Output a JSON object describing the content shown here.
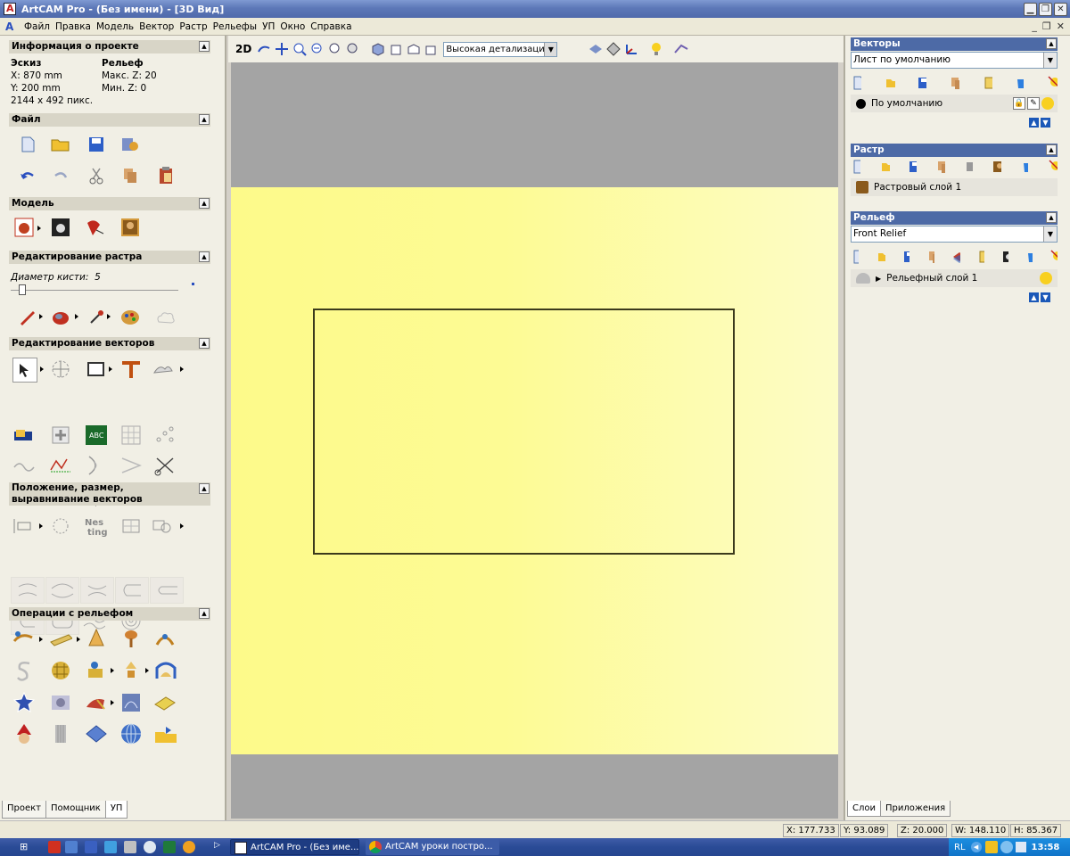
{
  "window": {
    "title": "ArtCAM Pro - (Без имени) - [3D Вид]"
  },
  "menu": [
    "Файл",
    "Правка",
    "Модель",
    "Вектор",
    "Растр",
    "Рельефы",
    "УП",
    "Окно",
    "Справка"
  ],
  "left": {
    "project_info": {
      "title": "Информация о проекте",
      "sketch_label": "Эскиз",
      "x": "X: 870 mm",
      "y": "Y: 200 mm",
      "pixels": "2144 x 492 пикс.",
      "relief_label": "Рельеф",
      "max_z": "Макс. Z: 20",
      "min_z": "Мин. Z: 0"
    },
    "file_title": "Файл",
    "model_title": "Модель",
    "raster_edit_title": "Редактирование растра",
    "brush_label": "Диаметр кисти:",
    "brush_value": "5",
    "brush_level": 0.05,
    "vector_edit_title": "Редактирование векторов",
    "position_title": "Положение, размер, выравнивание векторов",
    "relief_ops_title": "Операции с рельефом",
    "tabs": [
      "Проект",
      "Помощник",
      "УП"
    ]
  },
  "toolbar": {
    "mode_2d": "2D",
    "detail": "Высокая детализация"
  },
  "right": {
    "vectors": {
      "title": "Векторы",
      "sheet": "Лист по умолчанию",
      "layer": "По умолчанию"
    },
    "raster": {
      "title": "Растр",
      "layer": "Растровый слой 1"
    },
    "relief": {
      "title": "Рельеф",
      "combo": "Front Relief",
      "layer": "Рельефный слой 1"
    },
    "tabs": [
      "Слои",
      "Приложения"
    ]
  },
  "status": {
    "x": "X: 177.733",
    "y": "Y: 93.089",
    "z": "Z: 20.000",
    "w": "W: 148.110",
    "h": "H: 85.367"
  },
  "taskbar": {
    "task1": "ArtCAM Pro - (Без име...",
    "task2": "ArtCAM уроки постро...",
    "lang": "RL",
    "time": "13:58"
  },
  "colors": {
    "viewport_yellow": "#fdfa8a",
    "viewport_gray": "#a4a4a4",
    "panel_header_blue": "#4d6aa6"
  }
}
